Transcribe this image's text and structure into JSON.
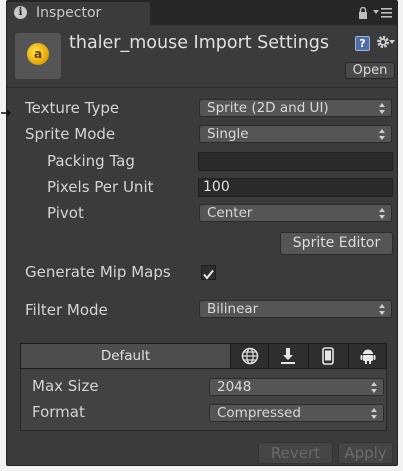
{
  "tab": {
    "title": "Inspector",
    "info_glyph": "i"
  },
  "header": {
    "title": "thaler_mouse Import Settings",
    "asset_glyph": "a",
    "help_glyph": "?",
    "open_label": "Open"
  },
  "fields": {
    "texture_type": {
      "label": "Texture Type",
      "value": "Sprite (2D and UI)"
    },
    "sprite_mode": {
      "label": "Sprite Mode",
      "value": "Single"
    },
    "packing_tag": {
      "label": "Packing Tag",
      "value": ""
    },
    "pixels_per_unit": {
      "label": "Pixels Per Unit",
      "value": "100"
    },
    "pivot": {
      "label": "Pivot",
      "value": "Center"
    },
    "sprite_editor_label": "Sprite Editor",
    "generate_mip_maps": {
      "label": "Generate Mip Maps",
      "checked": true
    },
    "filter_mode": {
      "label": "Filter Mode",
      "value": "Bilinear"
    }
  },
  "platforms": {
    "tabs": [
      {
        "label": "Default",
        "active": true
      },
      {
        "icon": "globe-icon"
      },
      {
        "icon": "download-icon"
      },
      {
        "icon": "mobile-icon"
      },
      {
        "icon": "android-icon"
      }
    ],
    "max_size": {
      "label": "Max Size",
      "value": "2048"
    },
    "format": {
      "label": "Format",
      "value": "Compressed"
    }
  },
  "footer": {
    "revert_label": "Revert",
    "apply_label": "Apply"
  },
  "colors": {
    "panel_bg": "#3b3b3b",
    "tabbar_bg": "#262626",
    "field_bg": "#555555",
    "text": "#d4d4d4",
    "disabled_text": "#6a6a6a"
  }
}
